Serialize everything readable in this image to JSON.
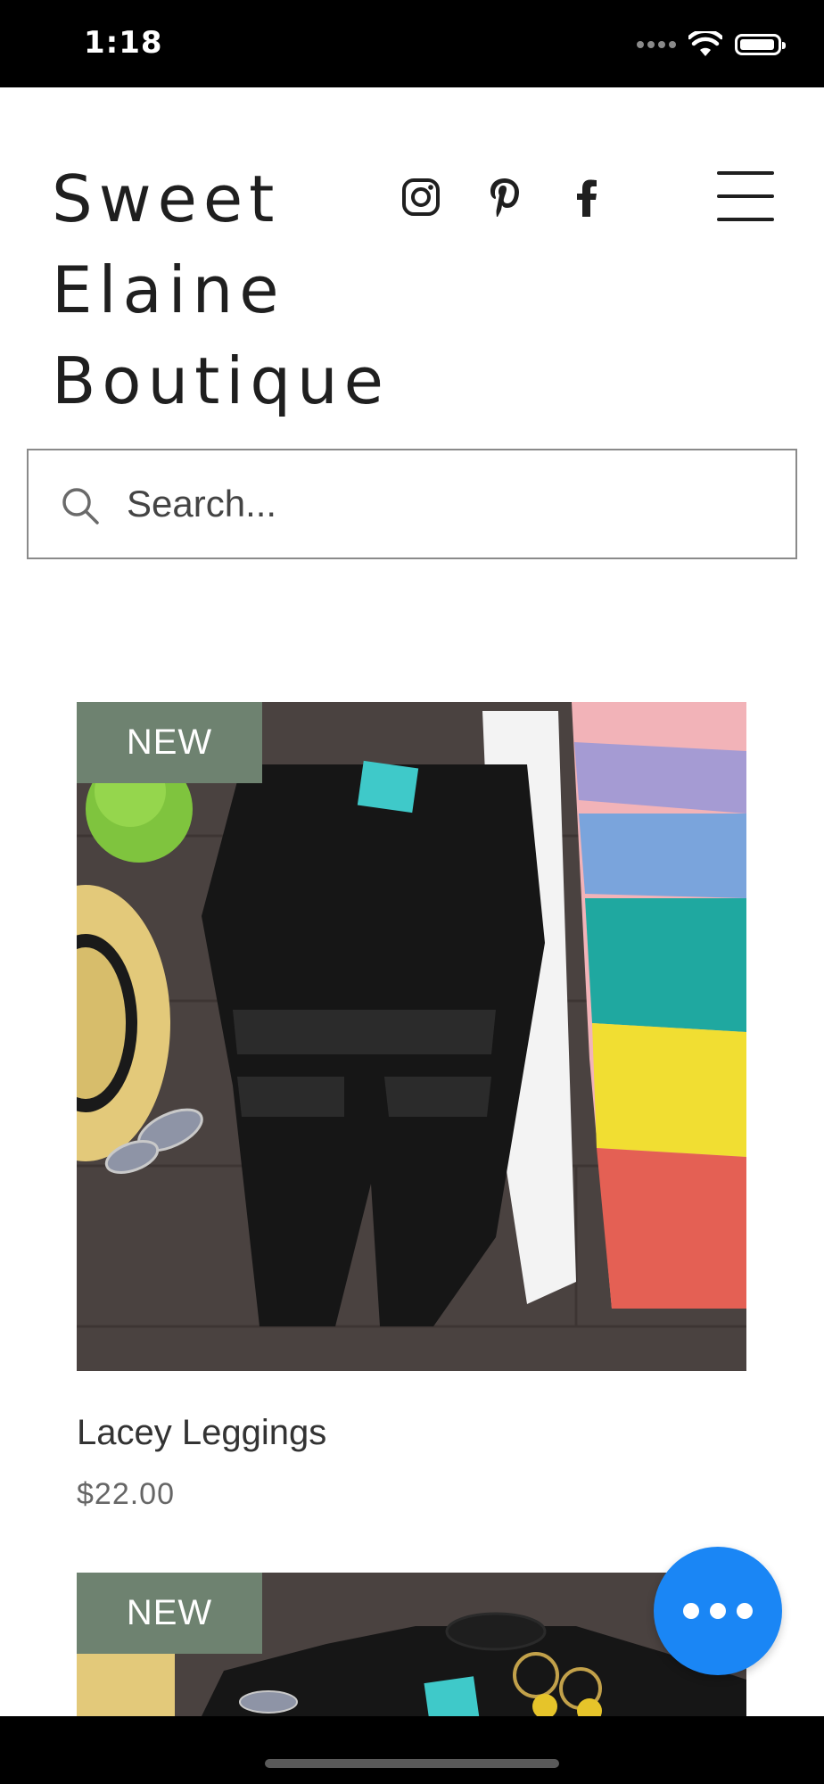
{
  "status_bar": {
    "time": "1:18"
  },
  "header": {
    "brand_lines": [
      "Sweet",
      "Elaine",
      "Boutique"
    ],
    "social_icons": [
      "instagram-icon",
      "pinterest-icon",
      "facebook-icon"
    ],
    "menu_icon": "hamburger-menu-icon"
  },
  "search": {
    "placeholder": "Search..."
  },
  "products": [
    {
      "badge": "NEW",
      "name": "Lacey Leggings",
      "price": "$22.00"
    },
    {
      "badge": "NEW"
    }
  ],
  "colors": {
    "badge_bg": "#6e8270",
    "chat_button": "#1a86f5",
    "text": "#1f1f1f"
  }
}
